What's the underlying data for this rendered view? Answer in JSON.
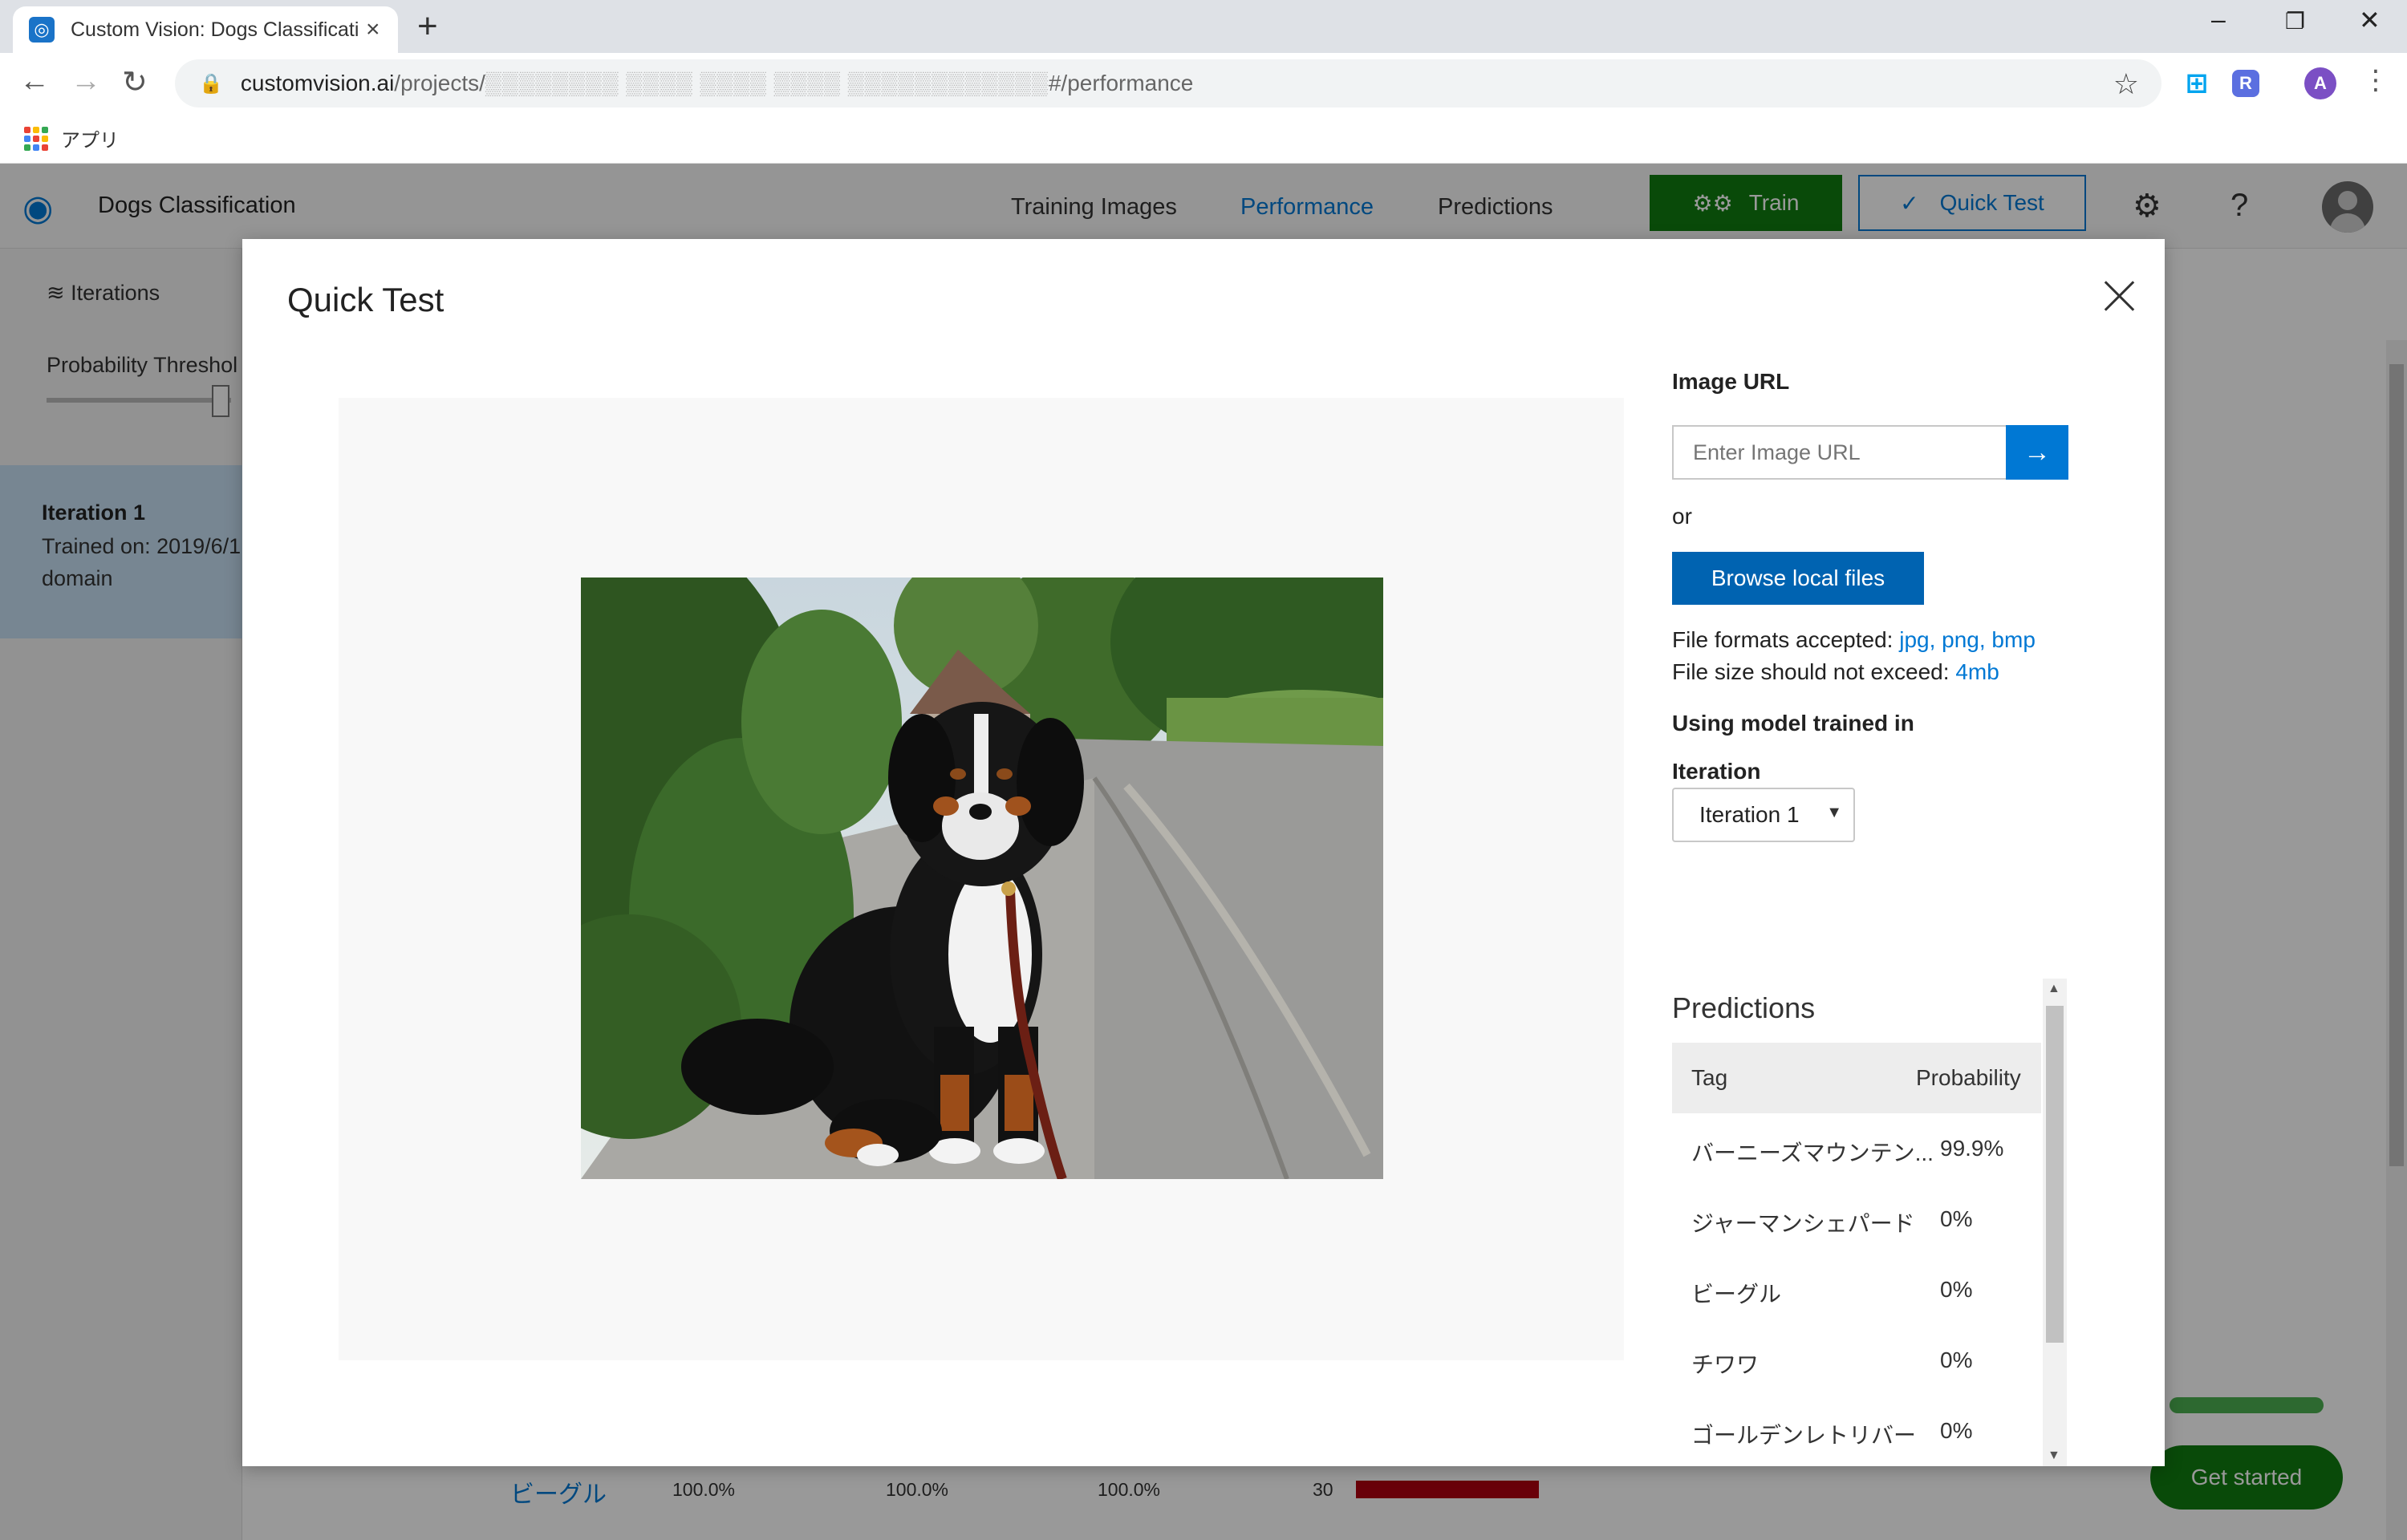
{
  "browser": {
    "tab_title": "Custom Vision: Dogs Classificatio",
    "tab_favicon": "custom-vision-icon",
    "url_host": "customvision.ai",
    "url_path_prefix": "/projects/",
    "url_path_blurred": "▒▒▒▒▒▒▒▒ ▒▒▒▒ ▒▒▒▒ ▒▒▒▒ ▒▒▒▒▒▒▒▒▒▒▒▒",
    "url_path_suffix": "#/performance",
    "bookmark_apps": "アプリ",
    "profile_initial": "A",
    "extension_initial": "R"
  },
  "app": {
    "project_name": "Dogs Classification",
    "nav": [
      "Training Images",
      "Performance",
      "Predictions"
    ],
    "active_nav": "Performance",
    "train_label": "Train",
    "quick_test_label": "Quick Test",
    "sidebar": {
      "iterations_label": "Iterations",
      "probability_label": "Probability Threshol",
      "iteration_name": "Iteration 1",
      "trained_on": "Trained on: 2019/6/1",
      "domain": "domain"
    },
    "background_row": {
      "tag": "ビーグル",
      "precision": "100.0%",
      "recall": "100.0%",
      "ap": "100.0%",
      "count": "30"
    },
    "get_started_label": "Get started"
  },
  "modal": {
    "title": "Quick Test",
    "image_url_label": "Image URL",
    "image_url_placeholder": "Enter Image URL",
    "or_label": "or",
    "browse_label": "Browse local files",
    "formats_prefix": "File formats accepted: ",
    "formats_value": "jpg, png, bmp",
    "size_prefix": "File size should not exceed: ",
    "size_value": "4mb",
    "model_label": "Using model trained in",
    "iteration_label": "Iteration",
    "iteration_selected": "Iteration 1",
    "predictions_title": "Predictions",
    "predictions_headers": {
      "tag": "Tag",
      "probability": "Probability"
    },
    "predictions": [
      {
        "tag": "バーニーズマウンテン...",
        "probability": "99.9%"
      },
      {
        "tag": "ジャーマンシェパード",
        "probability": "0%"
      },
      {
        "tag": "ビーグル",
        "probability": "0%"
      },
      {
        "tag": "チワワ",
        "probability": "0%"
      },
      {
        "tag": "ゴールデンレトリバー",
        "probability": "0%"
      }
    ]
  },
  "colors": {
    "accent": "#0078d4",
    "train_green": "#107c10",
    "browse_blue": "#0063b1",
    "selected_iteration": "#c7e0f4"
  }
}
